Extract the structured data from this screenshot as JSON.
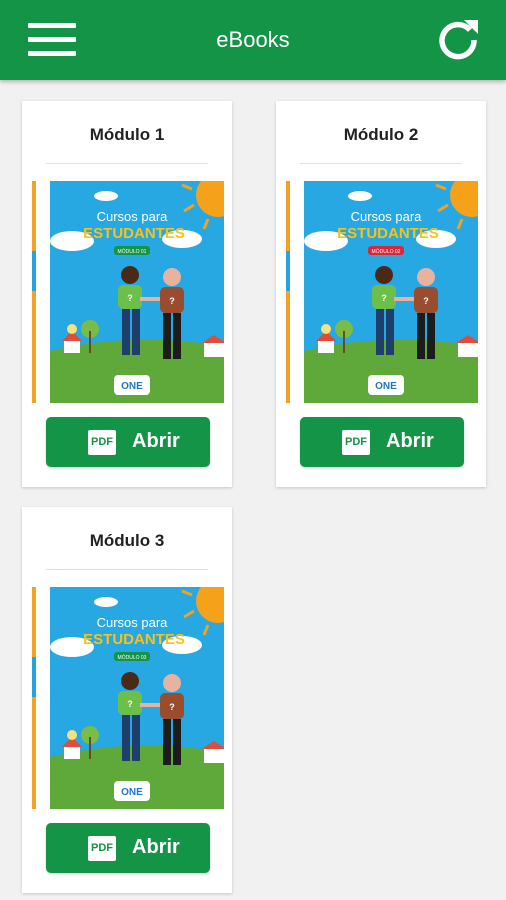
{
  "appbar": {
    "title": "eBooks",
    "menu_icon": "menu-icon",
    "refresh_icon": "refresh-icon",
    "color": "#139447"
  },
  "ebooks": [
    {
      "title": "Módulo 1",
      "cover": {
        "line1": "Cursos para",
        "line2": "ESTUDANTES",
        "badge": "MÓDULO 01",
        "badge_color": "#139447",
        "logo": "ONE"
      },
      "button_icon": "PDF",
      "button_label": "Abrir"
    },
    {
      "title": "Módulo 2",
      "cover": {
        "line1": "Cursos para",
        "line2": "ESTUDANTES",
        "badge": "MÓDULO 02",
        "badge_color": "#d9283a",
        "logo": "ONE"
      },
      "button_icon": "PDF",
      "button_label": "Abrir"
    },
    {
      "title": "Módulo 3",
      "cover": {
        "line1": "Cursos para",
        "line2": "ESTUDANTES",
        "badge": "MÓDULO 03",
        "badge_color": "#139447",
        "logo": "ONE"
      },
      "button_icon": "PDF",
      "button_label": "Abrir"
    }
  ]
}
